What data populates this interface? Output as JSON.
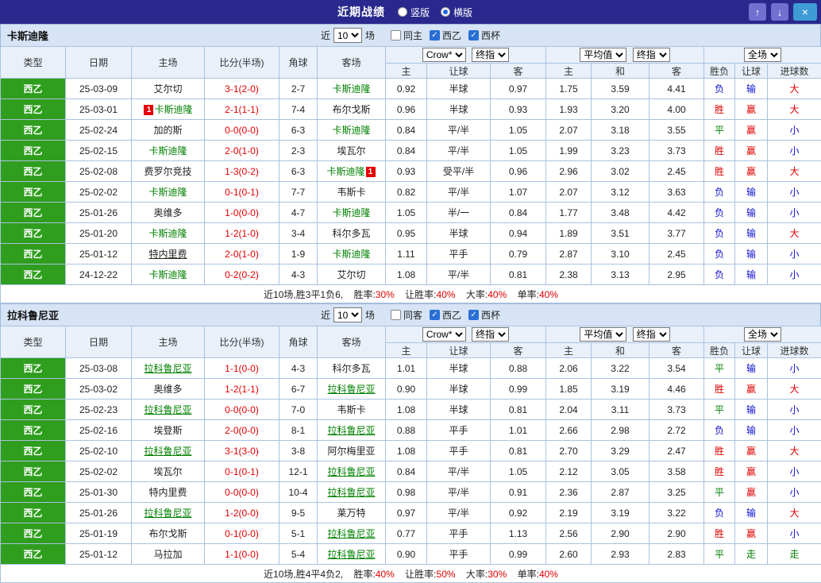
{
  "topbar": {
    "title": "近期战绩",
    "view_options": [
      {
        "label": "竖版",
        "selected": false
      },
      {
        "label": "横版",
        "selected": true
      }
    ],
    "up_button": "↑",
    "down_button": "↓",
    "close_button": "×"
  },
  "filter_labels": {
    "near": "近",
    "games": "场"
  },
  "selects": {
    "bookmaker": "Crow*",
    "final1": "终指",
    "average": "平均值",
    "final2": "终指",
    "full_game": "全场"
  },
  "table_header": {
    "type": "类型",
    "date": "日期",
    "home": "主场",
    "score": "比分(半场)",
    "corner": "角球",
    "away": "客场",
    "odds_home": "主",
    "odds_handicap": "让球",
    "odds_away": "客",
    "avg_home": "主",
    "avg_draw": "和",
    "avg_away": "客",
    "result_wdl": "胜负",
    "result_handicap": "让球",
    "result_goals": "进球数"
  },
  "colors": {
    "accent_green": "#2f9e1e",
    "win_red": "#e10000",
    "lose_blue": "#1010d0",
    "draw_green": "#008000",
    "topbar": "#28288d"
  },
  "sections": [
    {
      "team": "卡斯迪隆",
      "filter": {
        "count": "10",
        "same_label": "同主",
        "same_checked": false,
        "league1": "西乙",
        "league1_checked": true,
        "league2": "西杯",
        "league2_checked": true
      },
      "rows": [
        {
          "league": "西乙",
          "date": "25-03-09",
          "home": "艾尔切",
          "home_color": "black",
          "home_underline": false,
          "score": "3-1(2-0)",
          "corner": "2-7",
          "away": "卡斯迪隆",
          "away_color": "green",
          "away_underline": false,
          "odds_home": "0.92",
          "handicap": "半球",
          "odds_away": "0.97",
          "avg_home": "1.75",
          "avg_draw": "3.59",
          "avg_away": "4.41",
          "wdl": "负",
          "wdl_color": "blue",
          "asian": "输",
          "asian_color": "blue",
          "goals": "大",
          "goals_color": "red"
        },
        {
          "league": "西乙",
          "date": "25-03-01",
          "home": "卡斯迪隆",
          "home_color": "green",
          "home_underline": false,
          "home_badge": "1",
          "home_badge_pos": "left",
          "score": "2-1(1-1)",
          "corner": "7-4",
          "away": "布尔戈斯",
          "away_color": "black",
          "away_underline": false,
          "odds_home": "0.96",
          "handicap": "半球",
          "odds_away": "0.93",
          "avg_home": "1.93",
          "avg_draw": "3.20",
          "avg_away": "4.00",
          "wdl": "胜",
          "wdl_color": "red",
          "asian": "赢",
          "asian_color": "red",
          "goals": "大",
          "goals_color": "red"
        },
        {
          "league": "西乙",
          "date": "25-02-24",
          "home": "加的斯",
          "home_color": "black",
          "home_underline": false,
          "score": "0-0(0-0)",
          "corner": "6-3",
          "away": "卡斯迪隆",
          "away_color": "green",
          "away_underline": false,
          "odds_home": "0.84",
          "handicap": "平/半",
          "odds_away": "1.05",
          "avg_home": "2.07",
          "avg_draw": "3.18",
          "avg_away": "3.55",
          "wdl": "平",
          "wdl_color": "green",
          "asian": "赢",
          "asian_color": "red",
          "goals": "小",
          "goals_color": "blue"
        },
        {
          "league": "西乙",
          "date": "25-02-15",
          "home": "卡斯迪隆",
          "home_color": "green",
          "home_underline": false,
          "score": "2-0(1-0)",
          "corner": "2-3",
          "away": "埃瓦尔",
          "away_color": "black",
          "away_underline": false,
          "odds_home": "0.84",
          "handicap": "平/半",
          "odds_away": "1.05",
          "avg_home": "1.99",
          "avg_draw": "3.23",
          "avg_away": "3.73",
          "wdl": "胜",
          "wdl_color": "red",
          "asian": "赢",
          "asian_color": "red",
          "goals": "小",
          "goals_color": "blue"
        },
        {
          "league": "西乙",
          "date": "25-02-08",
          "home": "费罗尔竞技",
          "home_color": "black",
          "home_underline": false,
          "score": "1-3(0-2)",
          "corner": "6-3",
          "away": "卡斯迪隆",
          "away_color": "green",
          "away_underline": false,
          "away_badge": "1",
          "away_badge_pos": "right",
          "odds_home": "0.93",
          "handicap": "受平/半",
          "odds_away": "0.96",
          "avg_home": "2.96",
          "avg_draw": "3.02",
          "avg_away": "2.45",
          "wdl": "胜",
          "wdl_color": "red",
          "asian": "赢",
          "asian_color": "red",
          "goals": "大",
          "goals_color": "red"
        },
        {
          "league": "西乙",
          "date": "25-02-02",
          "home": "卡斯迪隆",
          "home_color": "green",
          "home_underline": false,
          "score": "0-1(0-1)",
          "corner": "7-7",
          "away": "韦斯卡",
          "away_color": "black",
          "away_underline": false,
          "odds_home": "0.82",
          "handicap": "平/半",
          "odds_away": "1.07",
          "avg_home": "2.07",
          "avg_draw": "3.12",
          "avg_away": "3.63",
          "wdl": "负",
          "wdl_color": "blue",
          "asian": "输",
          "asian_color": "blue",
          "goals": "小",
          "goals_color": "blue"
        },
        {
          "league": "西乙",
          "date": "25-01-26",
          "home": "奥维多",
          "home_color": "black",
          "home_underline": false,
          "score": "1-0(0-0)",
          "corner": "4-7",
          "away": "卡斯迪隆",
          "away_color": "green",
          "away_underline": false,
          "odds_home": "1.05",
          "handicap": "半/一",
          "odds_away": "0.84",
          "avg_home": "1.77",
          "avg_draw": "3.48",
          "avg_away": "4.42",
          "wdl": "负",
          "wdl_color": "blue",
          "asian": "输",
          "asian_color": "blue",
          "goals": "小",
          "goals_color": "blue"
        },
        {
          "league": "西乙",
          "date": "25-01-20",
          "home": "卡斯迪隆",
          "home_color": "green",
          "home_underline": false,
          "score": "1-2(1-0)",
          "corner": "3-4",
          "away": "科尔多瓦",
          "away_color": "black",
          "away_underline": false,
          "odds_home": "0.95",
          "handicap": "半球",
          "odds_away": "0.94",
          "avg_home": "1.89",
          "avg_draw": "3.51",
          "avg_away": "3.77",
          "wdl": "负",
          "wdl_color": "blue",
          "asian": "输",
          "asian_color": "blue",
          "goals": "大",
          "goals_color": "red"
        },
        {
          "league": "西乙",
          "date": "25-01-12",
          "home": "特内里费",
          "home_color": "black",
          "home_underline": true,
          "score": "2-0(1-0)",
          "corner": "1-9",
          "away": "卡斯迪隆",
          "away_color": "green",
          "away_underline": false,
          "odds_home": "1.11",
          "handicap": "平手",
          "odds_away": "0.79",
          "avg_home": "2.87",
          "avg_draw": "3.10",
          "avg_away": "2.45",
          "wdl": "负",
          "wdl_color": "blue",
          "asian": "输",
          "asian_color": "blue",
          "goals": "小",
          "goals_color": "blue"
        },
        {
          "league": "西乙",
          "date": "24-12-22",
          "home": "卡斯迪隆",
          "home_color": "green",
          "home_underline": false,
          "score": "0-2(0-2)",
          "corner": "4-3",
          "away": "艾尔切",
          "away_color": "black",
          "away_underline": false,
          "odds_home": "1.08",
          "handicap": "平/半",
          "odds_away": "0.81",
          "avg_home": "2.38",
          "avg_draw": "3.13",
          "avg_away": "2.95",
          "wdl": "负",
          "wdl_color": "blue",
          "asian": "输",
          "asian_color": "blue",
          "goals": "小",
          "goals_color": "blue"
        }
      ],
      "summary": {
        "prefix": "近10场,胜3平1负6,",
        "stats": [
          {
            "label": "胜率:",
            "value": "30%"
          },
          {
            "label": "让胜率:",
            "value": "40%"
          },
          {
            "label": "大率:",
            "value": "40%"
          },
          {
            "label": "单率:",
            "value": "40%"
          }
        ]
      }
    },
    {
      "team": "拉科鲁尼亚",
      "filter": {
        "count": "10",
        "same_label": "同客",
        "same_checked": false,
        "league1": "西乙",
        "league1_checked": true,
        "league2": "西杯",
        "league2_checked": true
      },
      "rows": [
        {
          "league": "西乙",
          "date": "25-03-08",
          "home": "拉科鲁尼亚",
          "home_color": "green",
          "home_underline": true,
          "score": "1-1(0-0)",
          "corner": "4-3",
          "away": "科尔多瓦",
          "away_color": "black",
          "away_underline": false,
          "odds_home": "1.01",
          "handicap": "半球",
          "odds_away": "0.88",
          "avg_home": "2.06",
          "avg_draw": "3.22",
          "avg_away": "3.54",
          "wdl": "平",
          "wdl_color": "green",
          "asian": "输",
          "asian_color": "blue",
          "goals": "小",
          "goals_color": "blue"
        },
        {
          "league": "西乙",
          "date": "25-03-02",
          "home": "奥维多",
          "home_color": "black",
          "home_underline": false,
          "score": "1-2(1-1)",
          "corner": "6-7",
          "away": "拉科鲁尼亚",
          "away_color": "green",
          "away_underline": true,
          "odds_home": "0.90",
          "handicap": "半球",
          "odds_away": "0.99",
          "avg_home": "1.85",
          "avg_draw": "3.19",
          "avg_away": "4.46",
          "wdl": "胜",
          "wdl_color": "red",
          "asian": "赢",
          "asian_color": "red",
          "goals": "大",
          "goals_color": "red"
        },
        {
          "league": "西乙",
          "date": "25-02-23",
          "home": "拉科鲁尼亚",
          "home_color": "green",
          "home_underline": true,
          "score": "0-0(0-0)",
          "corner": "7-0",
          "away": "韦斯卡",
          "away_color": "black",
          "away_underline": false,
          "odds_home": "1.08",
          "handicap": "半球",
          "odds_away": "0.81",
          "avg_home": "2.04",
          "avg_draw": "3.11",
          "avg_away": "3.73",
          "wdl": "平",
          "wdl_color": "green",
          "asian": "输",
          "asian_color": "blue",
          "goals": "小",
          "goals_color": "blue"
        },
        {
          "league": "西乙",
          "date": "25-02-16",
          "home": "埃登斯",
          "home_color": "black",
          "home_underline": false,
          "score": "2-0(0-0)",
          "corner": "8-1",
          "away": "拉科鲁尼亚",
          "away_color": "green",
          "away_underline": true,
          "odds_home": "0.88",
          "handicap": "平手",
          "odds_away": "1.01",
          "avg_home": "2.66",
          "avg_draw": "2.98",
          "avg_away": "2.72",
          "wdl": "负",
          "wdl_color": "blue",
          "asian": "输",
          "asian_color": "blue",
          "goals": "小",
          "goals_color": "blue"
        },
        {
          "league": "西乙",
          "date": "25-02-10",
          "home": "拉科鲁尼亚",
          "home_color": "green",
          "home_underline": true,
          "score": "3-1(3-0)",
          "corner": "3-8",
          "away": "阿尔梅里亚",
          "away_color": "black",
          "away_underline": false,
          "odds_home": "1.08",
          "handicap": "平手",
          "odds_away": "0.81",
          "avg_home": "2.70",
          "avg_draw": "3.29",
          "avg_away": "2.47",
          "wdl": "胜",
          "wdl_color": "red",
          "asian": "赢",
          "asian_color": "red",
          "goals": "大",
          "goals_color": "red"
        },
        {
          "league": "西乙",
          "date": "25-02-02",
          "home": "埃瓦尔",
          "home_color": "black",
          "home_underline": false,
          "score": "0-1(0-1)",
          "corner": "12-1",
          "away": "拉科鲁尼亚",
          "away_color": "green",
          "away_underline": true,
          "odds_home": "0.84",
          "handicap": "平/半",
          "odds_away": "1.05",
          "avg_home": "2.12",
          "avg_draw": "3.05",
          "avg_away": "3.58",
          "wdl": "胜",
          "wdl_color": "red",
          "asian": "赢",
          "asian_color": "red",
          "goals": "小",
          "goals_color": "blue"
        },
        {
          "league": "西乙",
          "date": "25-01-30",
          "home": "特内里费",
          "home_color": "black",
          "home_underline": false,
          "score": "0-0(0-0)",
          "corner": "10-4",
          "away": "拉科鲁尼亚",
          "away_color": "green",
          "away_underline": true,
          "odds_home": "0.98",
          "handicap": "平/半",
          "odds_away": "0.91",
          "avg_home": "2.36",
          "avg_draw": "2.87",
          "avg_away": "3.25",
          "wdl": "平",
          "wdl_color": "green",
          "asian": "赢",
          "asian_color": "red",
          "goals": "小",
          "goals_color": "blue"
        },
        {
          "league": "西乙",
          "date": "25-01-26",
          "home": "拉科鲁尼亚",
          "home_color": "green",
          "home_underline": true,
          "score": "1-2(0-0)",
          "corner": "9-5",
          "away": "莱万特",
          "away_color": "black",
          "away_underline": false,
          "odds_home": "0.97",
          "handicap": "平/半",
          "odds_away": "0.92",
          "avg_home": "2.19",
          "avg_draw": "3.19",
          "avg_away": "3.22",
          "wdl": "负",
          "wdl_color": "blue",
          "asian": "输",
          "asian_color": "blue",
          "goals": "大",
          "goals_color": "red"
        },
        {
          "league": "西乙",
          "date": "25-01-19",
          "home": "布尔戈斯",
          "home_color": "black",
          "home_underline": false,
          "score": "0-1(0-0)",
          "corner": "5-1",
          "away": "拉科鲁尼亚",
          "away_color": "green",
          "away_underline": true,
          "odds_home": "0.77",
          "handicap": "平手",
          "odds_away": "1.13",
          "avg_home": "2.56",
          "avg_draw": "2.90",
          "avg_away": "2.90",
          "wdl": "胜",
          "wdl_color": "red",
          "asian": "赢",
          "asian_color": "red",
          "goals": "小",
          "goals_color": "blue"
        },
        {
          "league": "西乙",
          "date": "25-01-12",
          "home": "马拉加",
          "home_color": "black",
          "home_underline": false,
          "score": "1-1(0-0)",
          "corner": "5-4",
          "away": "拉科鲁尼亚",
          "away_color": "green",
          "away_underline": true,
          "odds_home": "0.90",
          "handicap": "平手",
          "odds_away": "0.99",
          "avg_home": "2.60",
          "avg_draw": "2.93",
          "avg_away": "2.83",
          "wdl": "平",
          "wdl_color": "green",
          "asian": "走",
          "asian_color": "green",
          "goals": "走",
          "goals_color": "green"
        }
      ],
      "summary": {
        "prefix": "近10场,胜4平4负2,",
        "stats": [
          {
            "label": "胜率:",
            "value": "40%"
          },
          {
            "label": "让胜率:",
            "value": "50%"
          },
          {
            "label": "大率:",
            "value": "30%"
          },
          {
            "label": "单率:",
            "value": "40%"
          }
        ]
      }
    }
  ]
}
